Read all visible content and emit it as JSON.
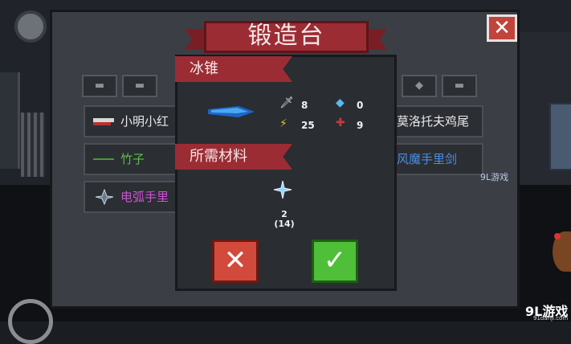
{
  "forge": {
    "title": "锻造台",
    "close_glyph": "✕"
  },
  "tabs": [
    "▬",
    "▬",
    "◆",
    "✧",
    "▬"
  ],
  "list": {
    "left": [
      {
        "name": "小明小红",
        "color": "#e8e8e8"
      },
      {
        "name": "竹子",
        "color": "#5fbf4a"
      },
      {
        "name": "电弧手里",
        "color": "#d050d8"
      }
    ],
    "right": [
      {
        "name": "莫洛托夫鸡尾",
        "color": "#e8e8e8"
      },
      {
        "name": "风魔手里剑",
        "color": "#4c8de0"
      }
    ]
  },
  "popup": {
    "item_name": "冰锥",
    "materials_label": "所需材料",
    "stats": {
      "attack": "8",
      "energy": "0",
      "critical": "25",
      "accuracy": "9"
    },
    "material_count": "2",
    "material_total": "(14)"
  },
  "buttons": {
    "cancel_glyph": "✕",
    "confirm_glyph": "✓"
  },
  "watermark": {
    "mid": "9L游戏",
    "br": "9L游戏",
    "br_sub": "91danji.com"
  },
  "colors": {
    "banner": "#9c2c34",
    "cancel": "#d24a3c",
    "confirm": "#4fbf3a",
    "ice": "#3a8de0"
  }
}
